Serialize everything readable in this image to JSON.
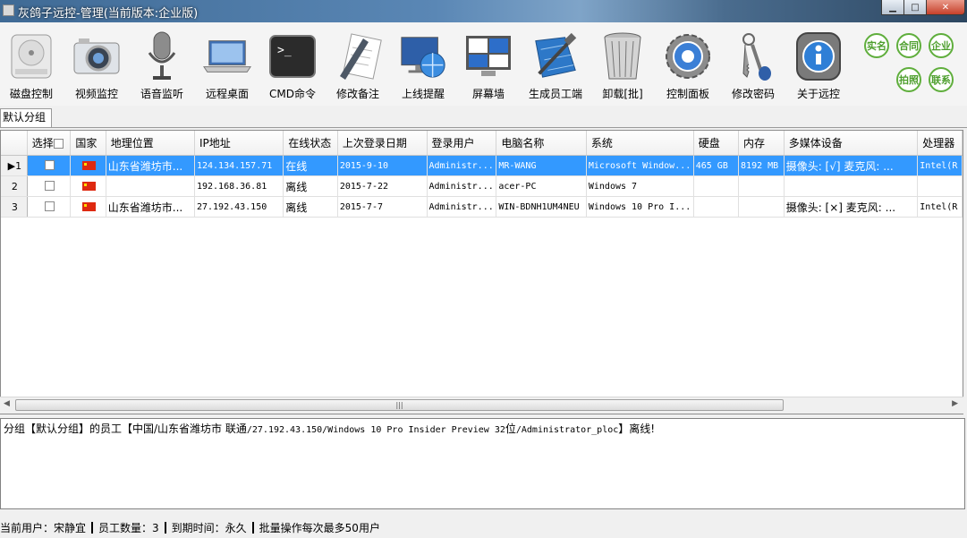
{
  "window": {
    "title": "灰鸽子远控-管理(当前版本:企业版)"
  },
  "toolbar": {
    "items": [
      {
        "label": "磁盘控制",
        "icon": "hard-disk-icon"
      },
      {
        "label": "视频监控",
        "icon": "camera-icon"
      },
      {
        "label": "语音监听",
        "icon": "microphone-icon"
      },
      {
        "label": "远程桌面",
        "icon": "laptop-icon"
      },
      {
        "label": "CMD命令",
        "icon": "terminal-icon"
      },
      {
        "label": "修改备注",
        "icon": "edit-note-icon"
      },
      {
        "label": "上线提醒",
        "icon": "globe-monitor-icon"
      },
      {
        "label": "屏幕墙",
        "icon": "screen-wall-icon"
      },
      {
        "label": "生成员工端",
        "icon": "build-tools-icon"
      },
      {
        "label": "卸载[批]",
        "icon": "trash-icon"
      },
      {
        "label": "控制面板",
        "icon": "control-panel-gear-icon"
      },
      {
        "label": "修改密码",
        "icon": "keys-icon"
      },
      {
        "label": "关于远控",
        "icon": "info-icon"
      }
    ],
    "badges": [
      "实名",
      "合同",
      "企业",
      "拍照",
      "联系"
    ]
  },
  "tabs": [
    "默认分组"
  ],
  "table": {
    "columns": [
      "选择",
      "国家",
      "地理位置",
      "IP地址",
      "在线状态",
      "上次登录日期",
      "登录用户",
      "电脑名称",
      "系统",
      "硬盘",
      "内存",
      "多媒体设备",
      "处理器"
    ],
    "rows": [
      {
        "num": "1",
        "country": "CN",
        "location": "山东省潍坊市...",
        "ip": "124.134.157.71",
        "status": "在线",
        "last_login": "2015-9-10",
        "user": "Administr...",
        "pc": "MR-WANG",
        "os": "Microsoft Window...",
        "disk": "465 GB",
        "mem": "8192 MB",
        "media": "摄像头: [√] 麦克风: ...",
        "cpu": "Intel(R",
        "selected": true
      },
      {
        "num": "2",
        "country": "CN",
        "location": "",
        "ip": "192.168.36.81",
        "status": "离线",
        "last_login": "2015-7-22",
        "user": "Administr...",
        "pc": "acer-PC",
        "os": "Windows 7",
        "disk": "",
        "mem": "",
        "media": "",
        "cpu": "",
        "selected": false
      },
      {
        "num": "3",
        "country": "CN",
        "location": "山东省潍坊市...",
        "ip": "27.192.43.150",
        "status": "离线",
        "last_login": "2015-7-7",
        "user": "Administr...",
        "pc": "WIN-BDNH1UM4NEU",
        "os": "Windows 10 Pro I...",
        "disk": "",
        "mem": "",
        "media": "摄像头: [×] 麦克风: ...",
        "cpu": "Intel(R",
        "selected": false
      }
    ]
  },
  "log": {
    "prefix": "分组【默认分组】的员工【中国/山东省潍坊市 联通",
    "middle": "/27.192.43.150/Windows 10 Pro Insider Preview 32",
    "suffix_cn": "位",
    "tail": "/Administrator_ploc",
    "end": "】离线!"
  },
  "status": {
    "user": "当前用户：宋静宜",
    "count": "员工数量：3",
    "expire": "到期时间：永久",
    "note": "批量操作每次最多50用户"
  },
  "colors": {
    "selection": "#3399ff",
    "badge": "#5fae3c"
  }
}
